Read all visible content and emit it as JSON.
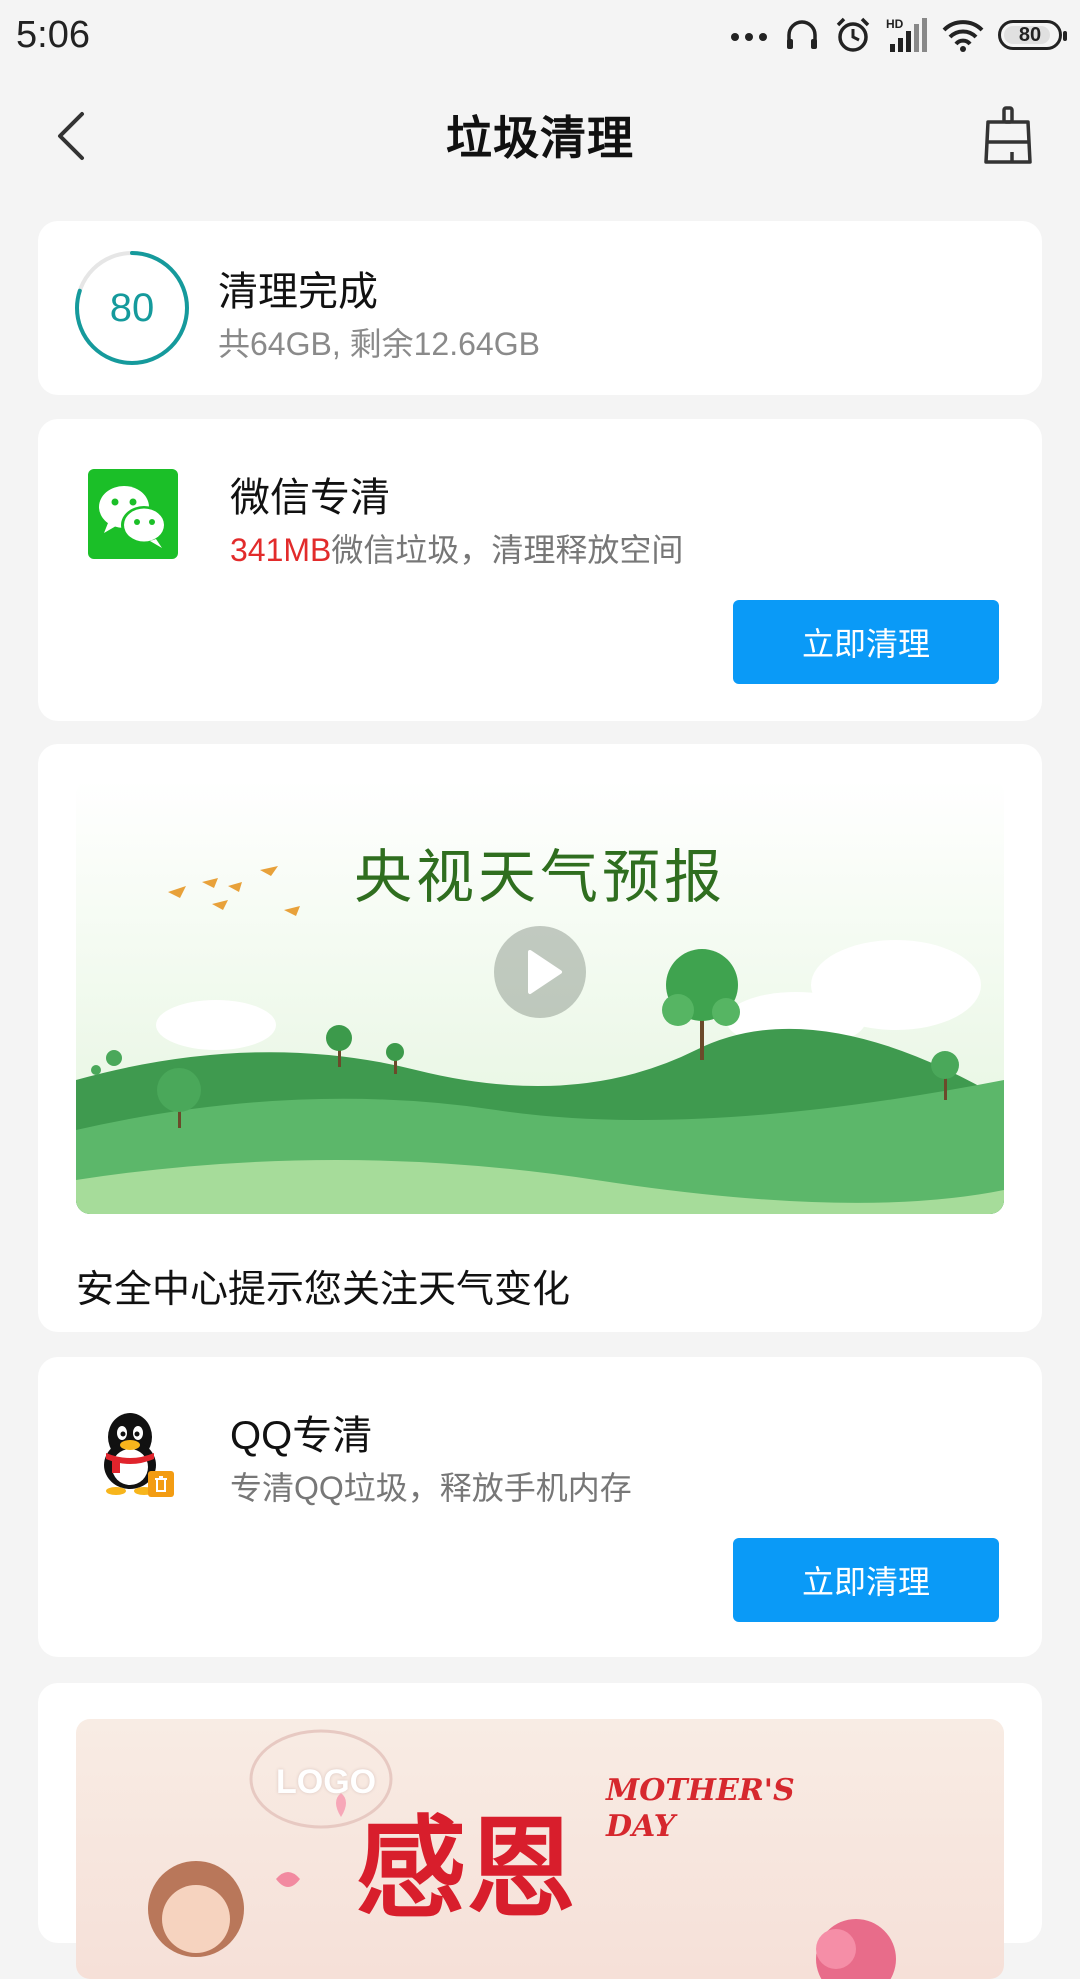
{
  "status_bar": {
    "time": "5:06",
    "battery_level": "80"
  },
  "nav": {
    "title": "垃圾清理"
  },
  "score_card": {
    "score": "80",
    "title": "清理完成",
    "subtitle": "共64GB, 剩余12.64GB"
  },
  "wechat_card": {
    "title": "微信专清",
    "desc_highlight": "341MB",
    "desc_rest": "微信垃圾，清理释放空间",
    "button_label": "立即清理"
  },
  "weather_ad": {
    "banner_title": "央视天气预报",
    "caption": "安全中心提示您关注天气变化"
  },
  "qq_card": {
    "title": "QQ专清",
    "desc": "专清QQ垃圾，释放手机内存",
    "button_label": "立即清理"
  },
  "promo_ad": {
    "logo": "LOGO",
    "cn_text": "感恩",
    "en_line1": "MOTHER'S",
    "en_line2": "DAY"
  },
  "colors": {
    "accent_blue": "#0a9af7",
    "score_teal": "#159a9c",
    "highlight_red": "#e22b2b",
    "wechat_green": "#1bbf28"
  }
}
